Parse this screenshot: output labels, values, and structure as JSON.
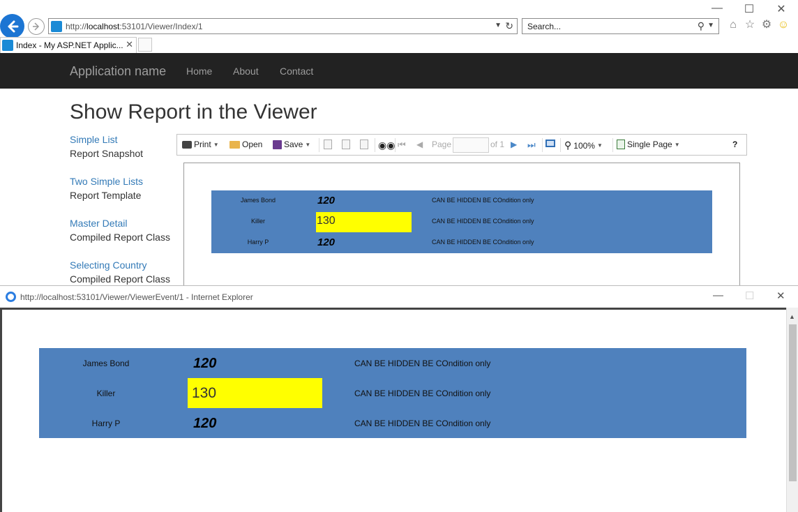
{
  "browser": {
    "url_prefix": "http://",
    "url_host": "localhost",
    "url_rest": ":53101/Viewer/Index/1",
    "search_placeholder": "Search...",
    "tab_title": "Index - My ASP.NET Applic..."
  },
  "site": {
    "brand": "Application name",
    "nav": [
      "Home",
      "About",
      "Contact"
    ],
    "page_title": "Show Report in the Viewer"
  },
  "menu": [
    {
      "link": "Simple List",
      "sub": "Report Snapshot"
    },
    {
      "link": "Two Simple Lists",
      "sub": "Report Template"
    },
    {
      "link": "Master Detail",
      "sub": "Compiled Report Class"
    },
    {
      "link": "Selecting Country",
      "sub": "Compiled Report Class"
    }
  ],
  "toolbar": {
    "print": "Print",
    "open": "Open",
    "save": "Save",
    "page_label": "Page",
    "page_of": "of 1",
    "zoom": "100%",
    "view_mode": "Single Page",
    "help": "?"
  },
  "report": {
    "rows": [
      {
        "name": "James Bond",
        "value": "120",
        "highlight": false,
        "note": "CAN BE HIDDEN BE COndition only"
      },
      {
        "name": "Killer",
        "value": "130",
        "highlight": true,
        "note": "CAN BE HIDDEN BE COndition only"
      },
      {
        "name": "Harry P",
        "value": "120",
        "highlight": false,
        "note": "CAN BE HIDDEN BE COndition only"
      }
    ]
  },
  "popup": {
    "title": "http://localhost:53101/Viewer/ViewerEvent/1 - Internet Explorer"
  },
  "colors": {
    "report_band": "#4f81bd",
    "highlight": "#ffff00",
    "navbar": "#222222"
  }
}
